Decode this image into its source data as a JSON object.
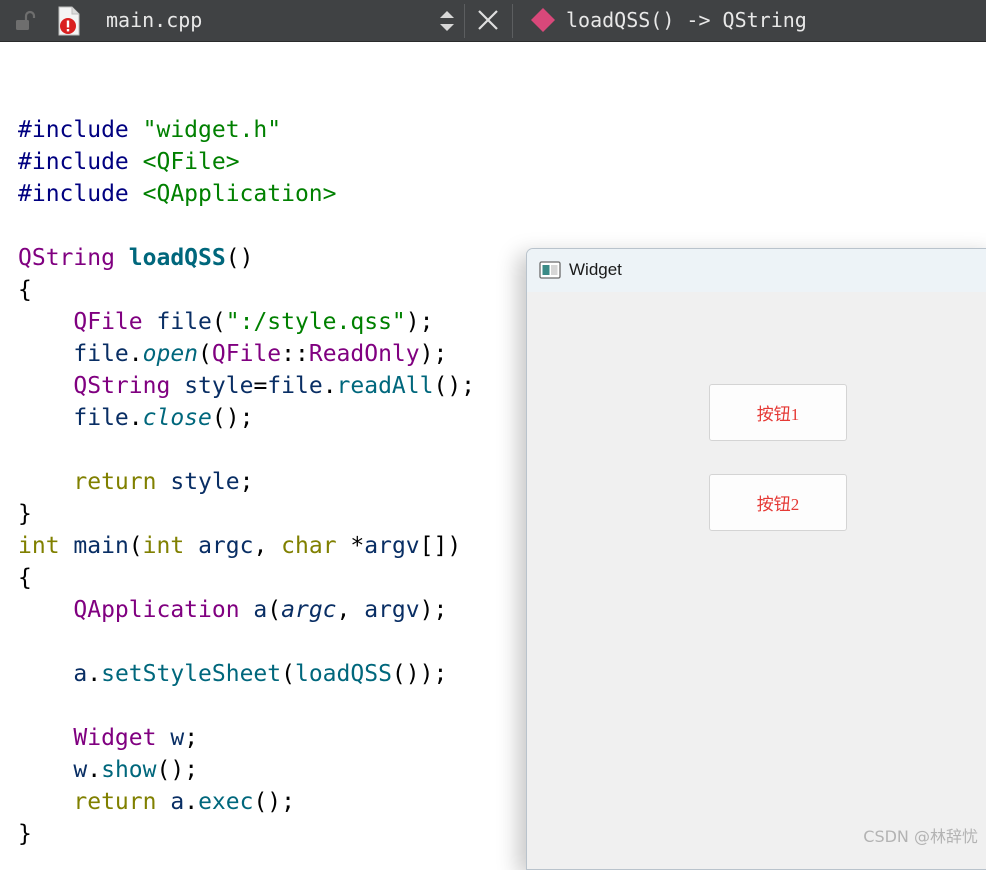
{
  "toolbar": {
    "file_name": "main.cpp",
    "function_signature": "loadQSS() -> QString",
    "icons": [
      "lock-icon",
      "file-error-icon",
      "updown-arrows-icon",
      "close-icon",
      "function-diamond-icon"
    ]
  },
  "code": {
    "lines": [
      [],
      [
        {
          "t": "#include ",
          "c": "pp"
        },
        {
          "t": "\"widget.h\"",
          "c": "str"
        }
      ],
      [
        {
          "t": "#include ",
          "c": "pp"
        },
        {
          "t": "<QFile>",
          "c": "str"
        }
      ],
      [
        {
          "t": "#include ",
          "c": "pp"
        },
        {
          "t": "<QApplication>",
          "c": "str"
        }
      ],
      [],
      [
        {
          "t": "QString",
          "c": "typ"
        },
        {
          "t": " ",
          "c": "plain"
        },
        {
          "t": "loadQSS",
          "c": "fnd"
        },
        {
          "t": "()",
          "c": "plain"
        }
      ],
      [
        {
          "t": "{",
          "c": "plain"
        }
      ],
      [
        {
          "t": "    ",
          "c": "plain"
        },
        {
          "t": "QFile",
          "c": "typ"
        },
        {
          "t": " ",
          "c": "plain"
        },
        {
          "t": "file",
          "c": "loc"
        },
        {
          "t": "(",
          "c": "plain"
        },
        {
          "t": "\":/style.qss\"",
          "c": "str"
        },
        {
          "t": ");",
          "c": "plain"
        }
      ],
      [
        {
          "t": "    ",
          "c": "plain"
        },
        {
          "t": "file",
          "c": "loc"
        },
        {
          "t": ".",
          "c": "plain"
        },
        {
          "t": "open",
          "c": "virt"
        },
        {
          "t": "(",
          "c": "plain"
        },
        {
          "t": "QFile",
          "c": "typ"
        },
        {
          "t": "::",
          "c": "plain"
        },
        {
          "t": "ReadOnly",
          "c": "enum"
        },
        {
          "t": ");",
          "c": "plain"
        }
      ],
      [
        {
          "t": "    ",
          "c": "plain"
        },
        {
          "t": "QString",
          "c": "typ"
        },
        {
          "t": " ",
          "c": "plain"
        },
        {
          "t": "style",
          "c": "loc"
        },
        {
          "t": "=",
          "c": "plain"
        },
        {
          "t": "file",
          "c": "loc"
        },
        {
          "t": ".",
          "c": "plain"
        },
        {
          "t": "readAll",
          "c": "fn"
        },
        {
          "t": "();",
          "c": "plain"
        }
      ],
      [
        {
          "t": "    ",
          "c": "plain"
        },
        {
          "t": "file",
          "c": "loc"
        },
        {
          "t": ".",
          "c": "plain"
        },
        {
          "t": "close",
          "c": "virt"
        },
        {
          "t": "();",
          "c": "plain"
        }
      ],
      [],
      [
        {
          "t": "    ",
          "c": "plain"
        },
        {
          "t": "return",
          "c": "kw"
        },
        {
          "t": " ",
          "c": "plain"
        },
        {
          "t": "style",
          "c": "loc"
        },
        {
          "t": ";",
          "c": "plain"
        }
      ],
      [
        {
          "t": "}",
          "c": "plain"
        }
      ],
      [
        {
          "t": "int",
          "c": "kw"
        },
        {
          "t": " ",
          "c": "plain"
        },
        {
          "t": "main",
          "c": "loc"
        },
        {
          "t": "(",
          "c": "plain"
        },
        {
          "t": "int",
          "c": "kw"
        },
        {
          "t": " ",
          "c": "plain"
        },
        {
          "t": "argc",
          "c": "loc"
        },
        {
          "t": ", ",
          "c": "plain"
        },
        {
          "t": "char",
          "c": "kw"
        },
        {
          "t": " *",
          "c": "plain"
        },
        {
          "t": "argv",
          "c": "loc"
        },
        {
          "t": "[])",
          "c": "plain"
        }
      ],
      [
        {
          "t": "{",
          "c": "plain"
        }
      ],
      [
        {
          "t": "    ",
          "c": "plain"
        },
        {
          "t": "QApplication",
          "c": "typ"
        },
        {
          "t": " ",
          "c": "plain"
        },
        {
          "t": "a",
          "c": "loc"
        },
        {
          "t": "(",
          "c": "plain"
        },
        {
          "t": "argc",
          "c": "par"
        },
        {
          "t": ", ",
          "c": "plain"
        },
        {
          "t": "argv",
          "c": "loc"
        },
        {
          "t": ");",
          "c": "plain"
        }
      ],
      [],
      [
        {
          "t": "    ",
          "c": "plain"
        },
        {
          "t": "a",
          "c": "loc"
        },
        {
          "t": ".",
          "c": "plain"
        },
        {
          "t": "setStyleSheet",
          "c": "fn"
        },
        {
          "t": "(",
          "c": "plain"
        },
        {
          "t": "loadQSS",
          "c": "fn"
        },
        {
          "t": "());",
          "c": "plain"
        }
      ],
      [],
      [
        {
          "t": "    ",
          "c": "plain"
        },
        {
          "t": "Widget",
          "c": "typ"
        },
        {
          "t": " ",
          "c": "plain"
        },
        {
          "t": "w",
          "c": "loc"
        },
        {
          "t": ";",
          "c": "plain"
        }
      ],
      [
        {
          "t": "    ",
          "c": "plain"
        },
        {
          "t": "w",
          "c": "loc"
        },
        {
          "t": ".",
          "c": "plain"
        },
        {
          "t": "show",
          "c": "fn"
        },
        {
          "t": "();",
          "c": "plain"
        }
      ],
      [
        {
          "t": "    ",
          "c": "plain"
        },
        {
          "t": "return",
          "c": "kw"
        },
        {
          "t": " ",
          "c": "plain"
        },
        {
          "t": "a",
          "c": "loc"
        },
        {
          "t": ".",
          "c": "plain"
        },
        {
          "t": "exec",
          "c": "fn"
        },
        {
          "t": "();",
          "c": "plain"
        }
      ],
      [
        {
          "t": "}",
          "c": "plain"
        }
      ]
    ]
  },
  "widget_window": {
    "title": "Widget",
    "buttons": [
      {
        "label": "按钮1"
      },
      {
        "label": "按钮2"
      }
    ],
    "button_text_color": "#e53935"
  },
  "watermark": "CSDN @林辞忧",
  "colors": {
    "toolbar_bg": "#404244",
    "preprocessor": "#000080",
    "string": "#008000",
    "type": "#800080",
    "keyword": "#808000",
    "function": "#00677c"
  }
}
